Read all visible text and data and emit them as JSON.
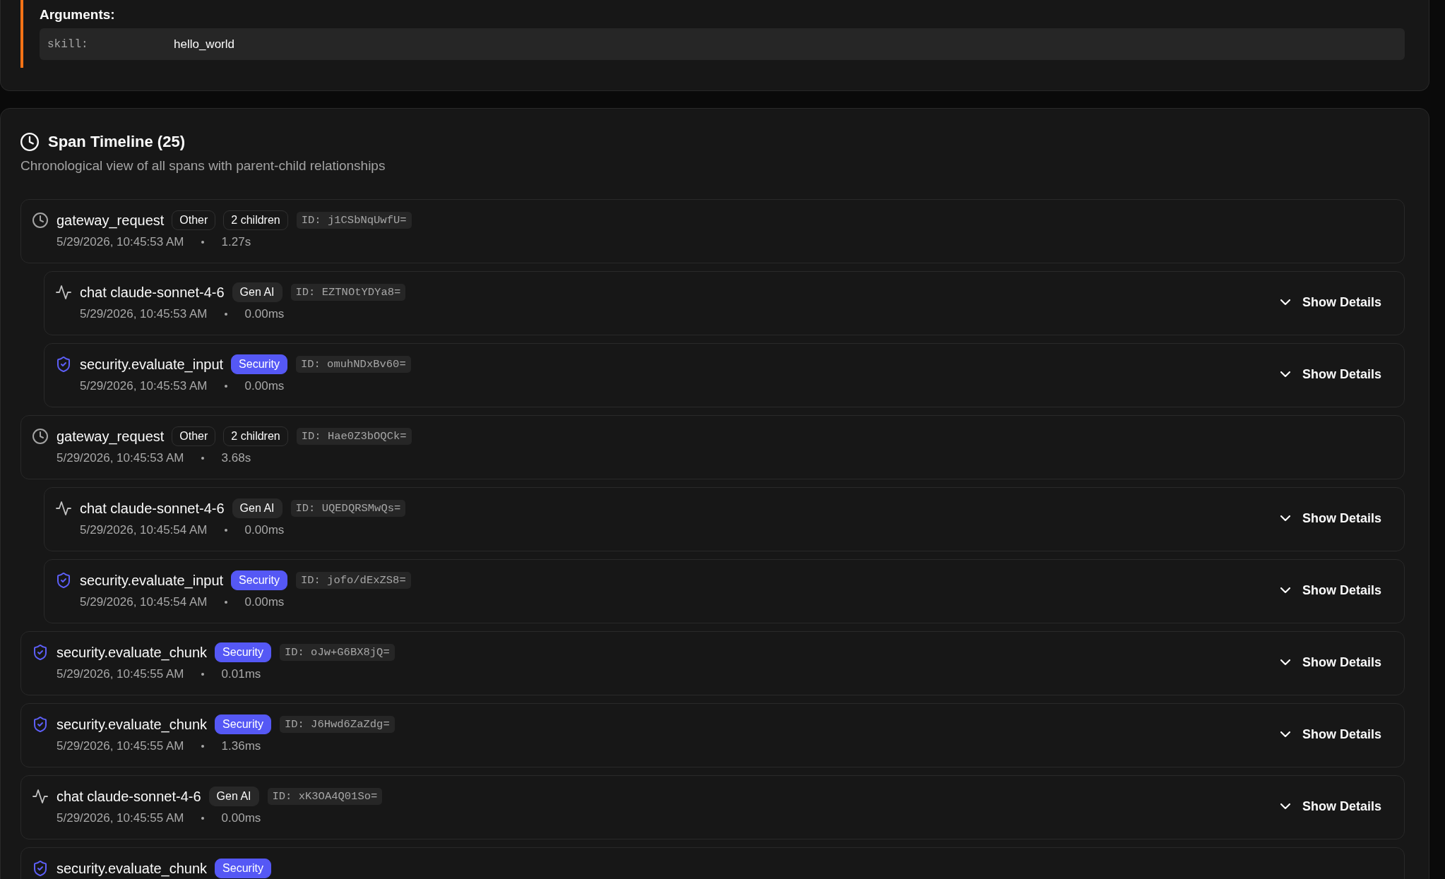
{
  "arguments_panel": {
    "title": "Arguments:",
    "arguments": [
      {
        "key": "skill:",
        "value": "hello_world"
      }
    ]
  },
  "span_timeline": {
    "title": "Span Timeline (25)",
    "subtitle": "Chronological view of all spans with parent-child relationships",
    "spans": [
      {
        "kind": "gateway",
        "name": "gateway_request",
        "category": "Other",
        "children_count": "2 children",
        "id": "ID: j1CSbNqUwfU=",
        "timestamp": "5/29/2026, 10:45:53 AM",
        "duration": "1.27s",
        "children": [
          {
            "kind": "chat",
            "name": "chat claude-sonnet-4-6",
            "category": "Gen AI",
            "id": "ID: EZTNOtYDYa8=",
            "timestamp": "5/29/2026, 10:45:53 AM",
            "duration": "0.00ms",
            "details_button": "Show Details"
          },
          {
            "kind": "security",
            "name": "security.evaluate_input",
            "category": "Security",
            "id": "ID: omuhNDxBv60=",
            "timestamp": "5/29/2026, 10:45:53 AM",
            "duration": "0.00ms",
            "details_button": "Show Details"
          }
        ]
      },
      {
        "kind": "gateway",
        "name": "gateway_request",
        "category": "Other",
        "children_count": "2 children",
        "id": "ID: Hae0Z3bOQCk=",
        "timestamp": "5/29/2026, 10:45:53 AM",
        "duration": "3.68s",
        "children": [
          {
            "kind": "chat",
            "name": "chat claude-sonnet-4-6",
            "category": "Gen AI",
            "id": "ID: UQEDQRSMwQs=",
            "timestamp": "5/29/2026, 10:45:54 AM",
            "duration": "0.00ms",
            "details_button": "Show Details"
          },
          {
            "kind": "security",
            "name": "security.evaluate_input",
            "category": "Security",
            "id": "ID: jofo/dExZS8=",
            "timestamp": "5/29/2026, 10:45:54 AM",
            "duration": "0.00ms",
            "details_button": "Show Details"
          }
        ]
      },
      {
        "kind": "security",
        "name": "security.evaluate_chunk",
        "category": "Security",
        "id": "ID: oJw+G6BX8jQ=",
        "timestamp": "5/29/2026, 10:45:55 AM",
        "duration": "0.01ms",
        "details_button": "Show Details"
      },
      {
        "kind": "security",
        "name": "security.evaluate_chunk",
        "category": "Security",
        "id": "ID: J6Hwd6ZaZdg=",
        "timestamp": "5/29/2026, 10:45:55 AM",
        "duration": "1.36ms",
        "details_button": "Show Details"
      },
      {
        "kind": "chat",
        "name": "chat claude-sonnet-4-6",
        "category": "Gen AI",
        "id": "ID: xK3OA4Q01So=",
        "timestamp": "5/29/2026, 10:45:55 AM",
        "duration": "0.00ms",
        "details_button": "Show Details"
      },
      {
        "kind": "security",
        "name": "security.evaluate_chunk",
        "category": "Security"
      }
    ]
  }
}
